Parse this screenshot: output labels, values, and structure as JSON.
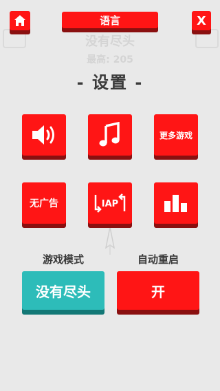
{
  "top_bar": {
    "language_label": "语言",
    "close_label": "X",
    "home_icon": "home-icon"
  },
  "background": {
    "game_title": "没有尽头",
    "score_line": "最高: 205"
  },
  "settings": {
    "heading": "- 设置 -",
    "buttons": {
      "sound_icon": "speaker-icon",
      "music_icon": "music-note-icon",
      "more_games_label": "更多游戏",
      "no_ads_label": "无广告",
      "iap_label": "IAP",
      "leaderboard_icon": "leaderboard-icon"
    },
    "game_mode": {
      "label": "游戏模式",
      "value": "没有尽头"
    },
    "auto_restart": {
      "label": "自动重启",
      "value": "开"
    }
  },
  "colors": {
    "red": "#ff1515",
    "red_shadow": "#8a1010",
    "teal": "#2dbcb9",
    "background": "#e9e9e9"
  }
}
